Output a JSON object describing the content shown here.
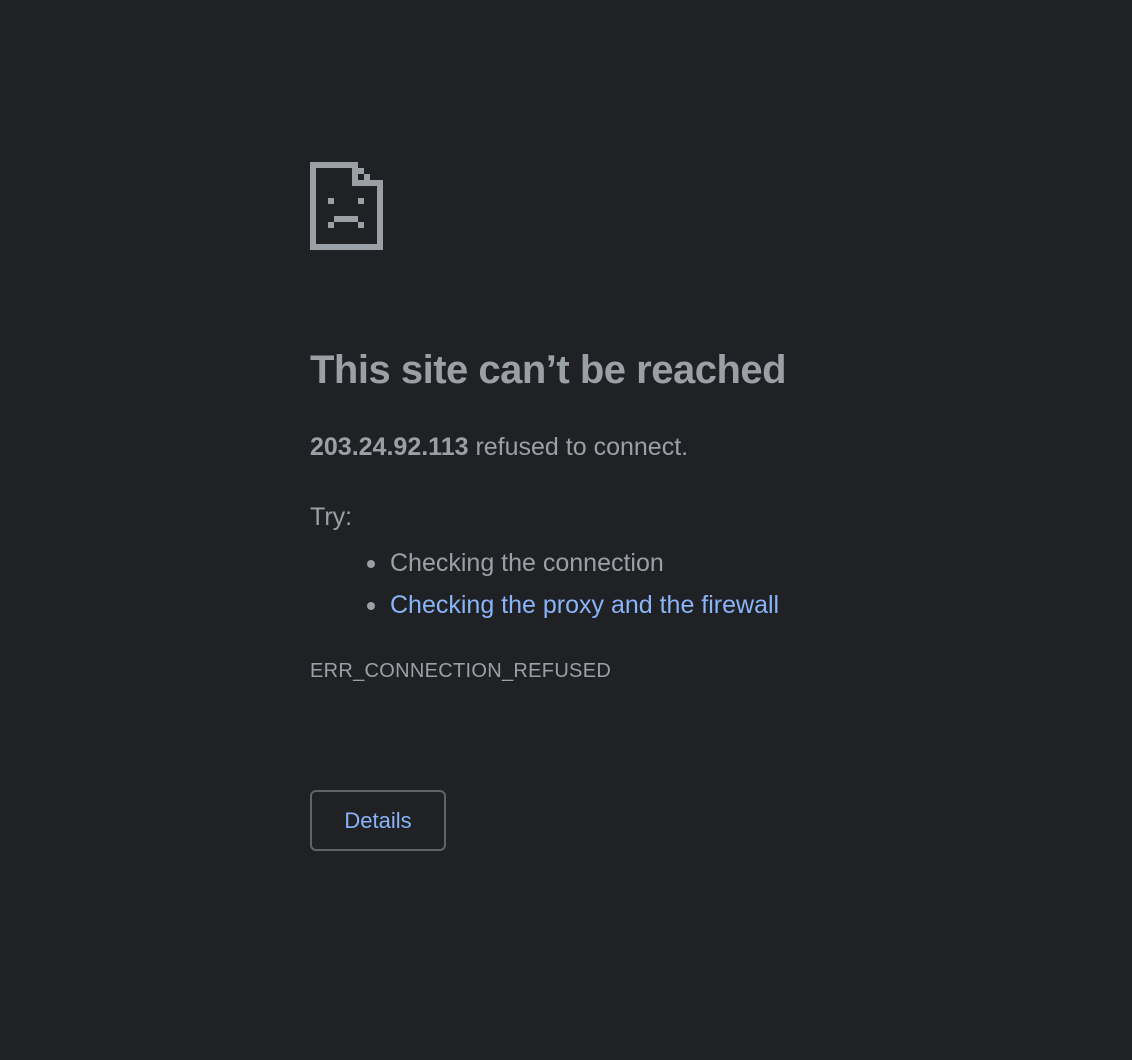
{
  "page": {
    "background_color": "#202124",
    "text_color": "#9aa0a6",
    "link_color": "#8ab4f8"
  },
  "icon": "sad-page-icon",
  "heading": "This site can’t be reached",
  "summary": {
    "host": "203.24.92.113",
    "message": " refused to connect."
  },
  "try": {
    "label": "Try:",
    "items": [
      {
        "text": "Checking the connection",
        "is_link": false
      },
      {
        "text": "Checking the proxy and the firewall",
        "is_link": true
      }
    ]
  },
  "error_code": "ERR_CONNECTION_REFUSED",
  "details_button": "Details"
}
